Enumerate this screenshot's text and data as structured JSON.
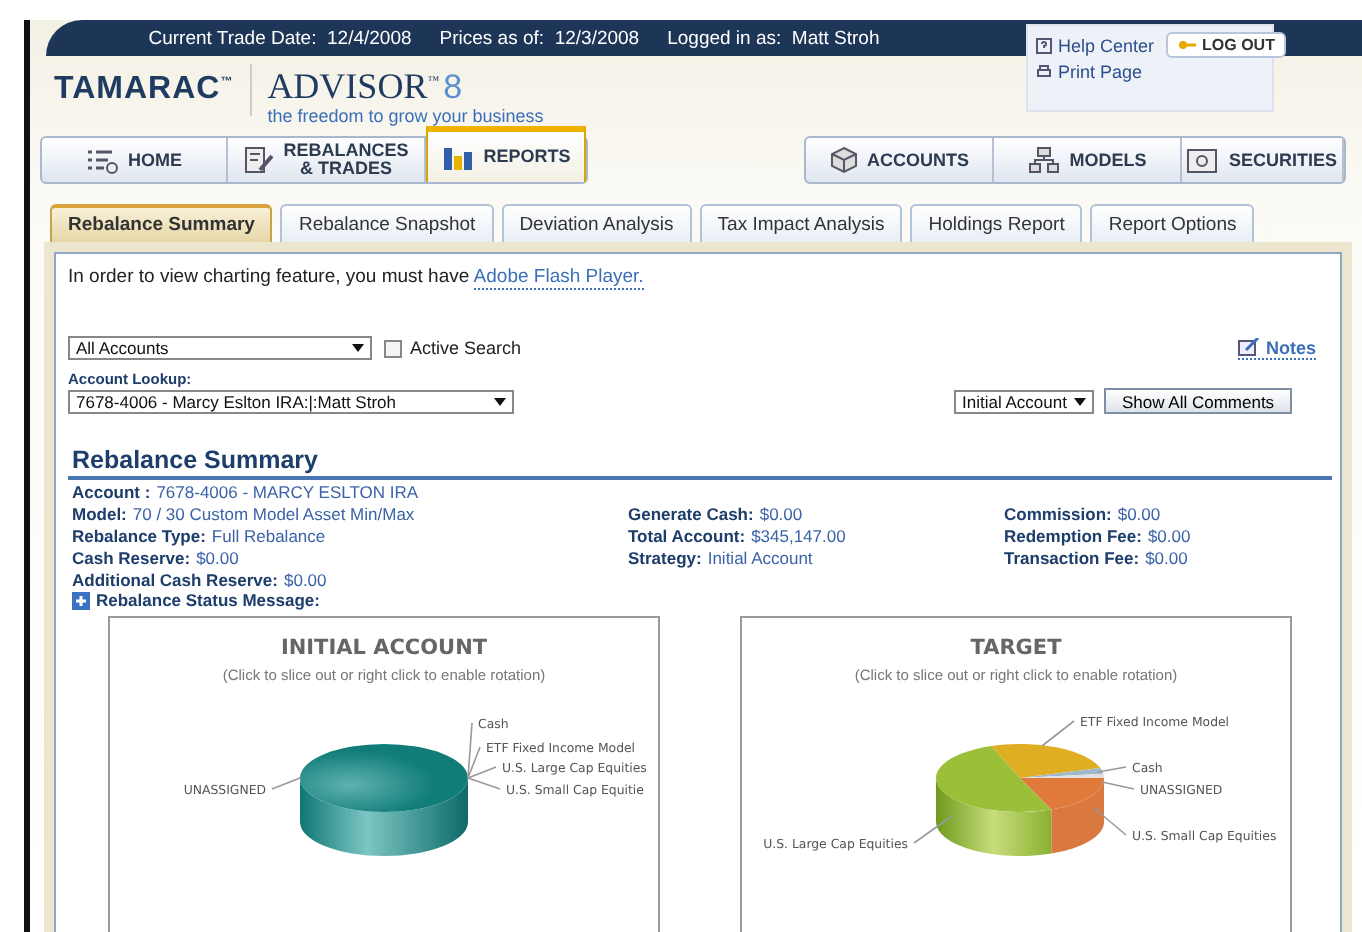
{
  "top_bar": {
    "items": [
      {
        "label": "Current Trade Date:",
        "value": "12/4/2008"
      },
      {
        "label": "Prices as of:",
        "value": "12/3/2008"
      },
      {
        "label": "Logged in as:",
        "value": "Matt Stroh"
      }
    ]
  },
  "brand": {
    "company": "TAMARAC$^{™}$",
    "product": "ADVISOR$^{™}$",
    "version": "8",
    "tagline": "the freedom to grow your business"
  },
  "utility": {
    "links": [
      {
        "label": "Help Center"
      },
      {
        "label": "Print Page"
      }
    ],
    "logout": "LOG OUT"
  },
  "nav_left": [
    {
      "label": "HOME",
      "selected": false
    },
    {
      "label": "REBALANCES\n& TRADES",
      "selected": false
    },
    {
      "label": "REPORTS",
      "selected": true
    }
  ],
  "nav_right": [
    {
      "label": "ACCOUNTS",
      "selected": false
    },
    {
      "label": "MODELS",
      "selected": false
    },
    {
      "label": "SECURITIES",
      "selected": false
    }
  ],
  "tabs": [
    {
      "label": "Rebalance Summary",
      "selected": true
    },
    {
      "label": "Rebalance Snapshot",
      "selected": false
    },
    {
      "label": "Deviation Analysis",
      "selected": false
    },
    {
      "label": "Tax Impact Analysis",
      "selected": false
    },
    {
      "label": "Holdings Report",
      "selected": false
    },
    {
      "label": "Report Options",
      "selected": false
    }
  ],
  "flash_notice": {
    "text": "In order to view charting feature, you must have",
    "link": "Adobe Flash Player."
  },
  "filters": {
    "scope": "All Accounts",
    "active_search": {
      "label": "Active Search",
      "checked": false
    },
    "notes": "Notes",
    "lookup_label": "Account Lookup:",
    "lookup_value": "7678-4006 - Marcy Eslton IRA:|:Matt Stroh",
    "view": "Initial Account",
    "comments_button": "Show All Comments"
  },
  "summary": {
    "title": "Rebalance Summary",
    "rows": [
      [
        {
          "label": "Account :",
          "value": "7678-4006 - MARCY ESLTON IRA"
        }
      ],
      [
        {
          "label": "Model:",
          "value": "70 / 30 Custom Model Asset Min/Max"
        },
        {
          "label": "Generate Cash:",
          "value": "$0.00"
        },
        {
          "label": "Commission:",
          "value": "$0.00"
        }
      ],
      [
        {
          "label": "Rebalance Type:",
          "value": "Full Rebalance"
        },
        {
          "label": "Total Account:",
          "value": "$345,147.00"
        },
        {
          "label": "Redemption Fee:",
          "value": "$0.00"
        }
      ],
      [
        {
          "label": "Cash Reserve:",
          "value": "$0.00"
        },
        {
          "label": "Strategy:",
          "value": "Initial Account"
        },
        {
          "label": "Transaction Fee:",
          "value": "$0.00"
        }
      ],
      [
        {
          "label": "Additional Cash Reserve:",
          "value": "$0.00"
        }
      ]
    ],
    "status_message": {
      "label": "Rebalance Status Message:",
      "expanded": false
    }
  },
  "charts": [
    {
      "kind": "single",
      "title": "INITIAL ACCOUNT",
      "subtitle": "(Click to slice out or right click to enable rotation)",
      "labels": [
        "Cash",
        "ETF Fixed Income Model",
        "U.S. Large Cap Equities",
        "UNASSIGNED",
        "U.S. Small Cap Equitie"
      ]
    },
    {
      "kind": "mixed",
      "title": "TARGET",
      "subtitle": "(Click to slice out or right click to enable rotation)",
      "labels": [
        "ETF Fixed Income Model",
        "Cash",
        "UNASSIGNED",
        "U.S. Small Cap Equities",
        "U.S. Large Cap Equities"
      ]
    }
  ]
}
